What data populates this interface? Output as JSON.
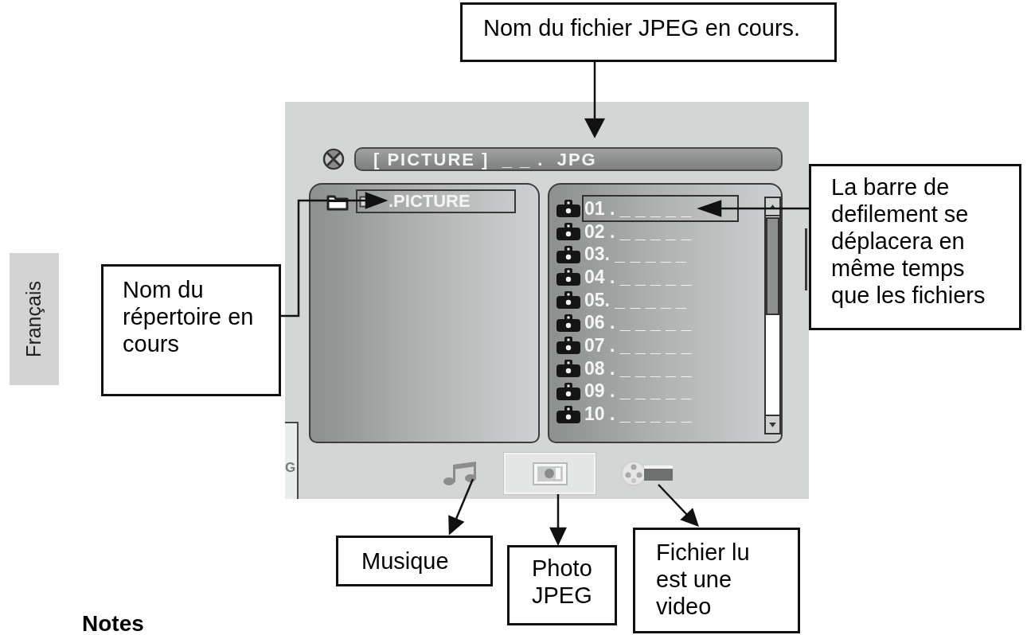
{
  "callouts": [
    {
      "kind": "file_name",
      "text": "Nom du fichier JPEG en cours."
    },
    {
      "kind": "scrollbar",
      "text": "La barre de defilement se déplacera en même temps que les fichiers"
    },
    {
      "kind": "folder_name",
      "text": "Nom du répertoire en cours"
    },
    {
      "kind": "music",
      "text": "Musique"
    },
    {
      "kind": "photo",
      "text": "Photo JPEG"
    },
    {
      "kind": "video",
      "text": "Fichier lu est une video"
    }
  ],
  "side_tab": "Français",
  "osd": {
    "title_bar": "[ PICTURE ]  _ _ .  JPG",
    "folders": [
      {
        "label": ".PICTURE",
        "selected": true
      }
    ],
    "files": [
      {
        "label": "01 . _ _ _ _ _",
        "selected": true
      },
      {
        "label": "02 . _ _ _ _ _",
        "selected": false
      },
      {
        "label": "03. _ _ _ _ _",
        "selected": false
      },
      {
        "label": "04 . _ _ _ _ _",
        "selected": false
      },
      {
        "label": "05. _ _ _ _ _",
        "selected": false
      },
      {
        "label": "06 . _ _ _ _ _",
        "selected": false
      },
      {
        "label": "07 . _ _ _ _ _",
        "selected": false
      },
      {
        "label": "08 . _ _ _ _ _",
        "selected": false
      },
      {
        "label": "09 . _ _ _ _ _",
        "selected": false
      },
      {
        "label": "10 . _ _ _ _ _",
        "selected": false
      }
    ],
    "modes": [
      {
        "kind": "music",
        "selected": false
      },
      {
        "kind": "photo",
        "selected": true
      },
      {
        "kind": "video",
        "selected": false
      }
    ],
    "edge_text": "G"
  },
  "notes_heading": "Notes"
}
